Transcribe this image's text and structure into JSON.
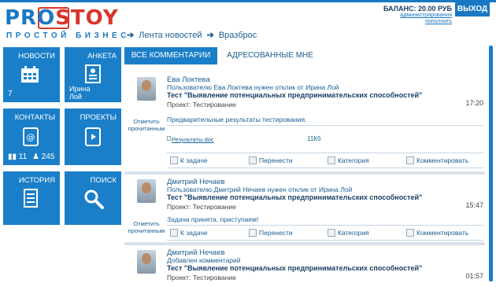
{
  "header": {
    "logo_pro": "PRO",
    "logo_stoy": "STOY",
    "logo_subtitle": "ПРОСТОЙ БИЗНЕС",
    "breadcrumb": [
      "Лента новостей",
      "Вразброс"
    ],
    "balance": "БАЛАНС: 20.00 РУБ",
    "admin_link": "администрирования",
    "topup_link": "пополнить",
    "exit": "ВЫХОД"
  },
  "tiles": {
    "news": {
      "label": "НОВОСТИ",
      "count": "7"
    },
    "profile": {
      "label": "АНКЕТА",
      "sub1": "Ирина",
      "sub2": "Лой"
    },
    "contacts": {
      "label": "КОНТАКТЫ",
      "count1": "11",
      "count2": "245"
    },
    "projects": {
      "label": "ПРОЕКТЫ"
    },
    "history": {
      "label": "ИСТОРИЯ"
    },
    "search": {
      "label": "ПОИСК"
    }
  },
  "tabs": {
    "all": "ВСЕ КОММЕНТАРИИ",
    "addressed": "АДРЕСОВАННЫЕ МНЕ"
  },
  "mark_read": "Отметить прочитанным",
  "posts": [
    {
      "author": "Ева Локтева",
      "meta": "Пользователю Ева Локтева нужен отклик от Ирина Лой",
      "test": "Тест \"Выявление потенциальных предпринимательских способностей\"",
      "project": "Проект: Тестирование",
      "time": "17:20",
      "comment": "Предварительные результаты тестирования.",
      "attachment": "Результаты.doc",
      "size": "11Кб"
    },
    {
      "author": "Дмитрий Нечаев",
      "meta": "Пользователю Дмитрий Нечаев нужен отклик от Ирина Лой",
      "test": "Тест \"Выявление потенциальных предпринимательских способностей\"",
      "project": "Проект: Тестирование",
      "time": "15:47",
      "comment": "Задача принята, приступаем!"
    },
    {
      "author": "Дмитрий Нечаев",
      "meta": "Добавлен комментарий",
      "test": "Тест \"Выявление потенциальных предпринимательских способностей\"",
      "project": "Проект: Тестирование",
      "time": "01:57"
    }
  ],
  "actions": {
    "task": "К задаче",
    "move": "Перенести",
    "category": "Категория",
    "comment": "Комментировать"
  }
}
